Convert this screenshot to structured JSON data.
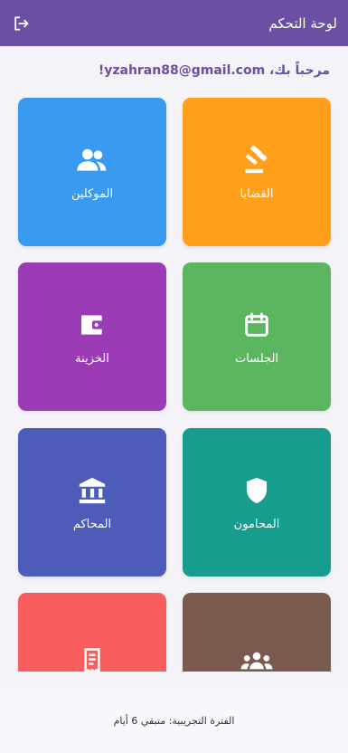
{
  "appbar": {
    "title": "لوحة التحكم",
    "logout_icon": "logout-icon",
    "color": "#6a4fa3"
  },
  "welcome": {
    "text": "مرحباً بك، yzahran88@gmail.com!"
  },
  "tiles": [
    {
      "label": "القضايا",
      "icon": "gavel-icon",
      "color": "#ff9f1a"
    },
    {
      "label": "الموكلين",
      "icon": "users-icon",
      "color": "#3a9af0"
    },
    {
      "label": "الجلسات",
      "icon": "calendar-icon",
      "color": "#5cb660"
    },
    {
      "label": "الخزينة",
      "icon": "wallet-icon",
      "color": "#9c3bb6"
    },
    {
      "label": "المحامون",
      "icon": "shield-icon",
      "color": "#169d8d"
    },
    {
      "label": "المحاكم",
      "icon": "bank-icon",
      "color": "#4d5cb8"
    },
    {
      "label": "",
      "icon": "group-icon",
      "color": "#7a5a4e"
    },
    {
      "label": "",
      "icon": "receipt-icon",
      "color": "#fa5d5d"
    }
  ],
  "footer": {
    "trial_text": "الفترة التجريبية: متبقي 6 أيام"
  }
}
